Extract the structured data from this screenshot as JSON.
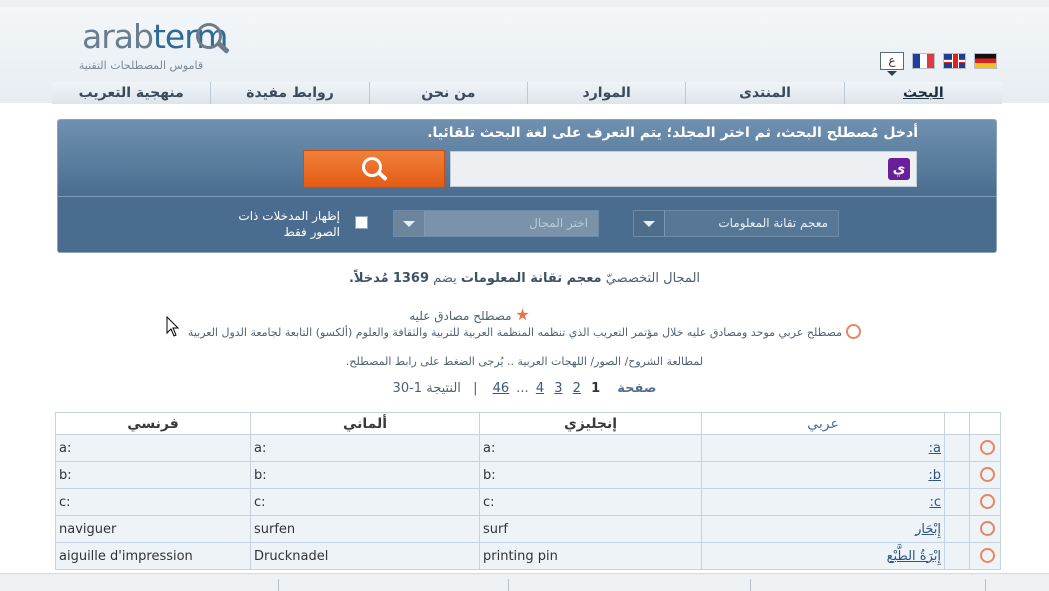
{
  "logo": {
    "word_a": "arab",
    "word_b": "term",
    "subtitle": "قاموس المصطلحات التقنية"
  },
  "languages": {
    "current": "ع",
    "flags": [
      "french-flag",
      "uk-flag",
      "german-flag"
    ]
  },
  "nav": {
    "items": [
      {
        "label": "البحث"
      },
      {
        "label": "المنتدى"
      },
      {
        "label": "الموارد"
      },
      {
        "label": "من نحن"
      },
      {
        "label": "روابط مفيدة"
      },
      {
        "label": "منهجية التعريب"
      }
    ]
  },
  "search": {
    "instruction": "أدخل مُصطلح البحث، ثم اختر المجلد؛ يتم التعرف على لغة البحث تلقائيا.",
    "input_value": "",
    "keyboard_icon": "ي",
    "domain_select": "معجم تقانة المعلومات",
    "field_select": "اختر المجال",
    "images_only_label": "إظهار المدخلات ذات الصور فقط",
    "images_only_checked": false
  },
  "summary": {
    "prefix": "المجال التخصصيّ",
    "domain_name": "معجم تقانة المعلومات",
    "contains": "يضم",
    "count": "1369",
    "suffix": "مُدخلاً."
  },
  "legend": {
    "approved": "مصطلح مصادق عليه",
    "unified": "مصطلح عربي موحد ومصادق عليه خلال مؤتمر التعريب الذي تنظمه المنظمة العربية للتربية والثقافة والعلوم (ألكسو) التابعة لجامعة الدول العربية",
    "click_note": "لمطالعة الشروح/ الصور/ اللهجات العربية .. يُرجى الضغط على رابط المصطلح."
  },
  "pager": {
    "label": "صفحة",
    "current": "1",
    "pages": [
      "2",
      "3",
      "4"
    ],
    "ellipsis": "...",
    "last": "46",
    "results_label": "النتيجة",
    "results_range": "1-30"
  },
  "table": {
    "headers": {
      "arabic": "عربي",
      "english": "إنجليزي",
      "german": "ألماني",
      "french": "فرنسي"
    },
    "rows": [
      {
        "arabic": "a:",
        "english": "a:",
        "german": "a:",
        "french": "a:"
      },
      {
        "arabic": "b:",
        "english": "b:",
        "german": "b:",
        "french": "b:"
      },
      {
        "arabic": "c:",
        "english": "c:",
        "german": "c:",
        "french": "c:"
      },
      {
        "arabic": "إِبْحَار",
        "english": "surf",
        "german": "surfen",
        "french": "naviguer"
      },
      {
        "arabic": "إِبْرَةُ الطَّبْع",
        "english": "printing pin",
        "german": "Drucknadel",
        "french": "aiguille d'impression"
      }
    ]
  },
  "colors": {
    "accent_orange": "#e45b16",
    "panel_blue": "#4a6d8f",
    "link_blue": "#2d5580",
    "ring_orange": "#e58765"
  }
}
